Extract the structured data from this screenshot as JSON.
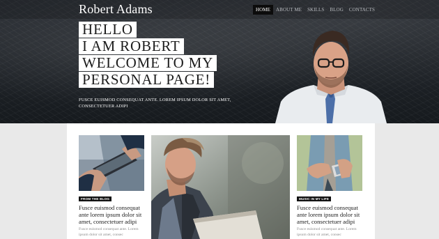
{
  "header": {
    "site_title": "Robert Adams",
    "nav": [
      {
        "label": "HOME",
        "active": true
      },
      {
        "label": "ABOUT ME",
        "active": false
      },
      {
        "label": "SKILLS",
        "active": false
      },
      {
        "label": "BLOG",
        "active": false
      },
      {
        "label": "CONTACTS",
        "active": false
      }
    ]
  },
  "hero": {
    "headline": [
      "HELLO",
      "I AM ROBERT",
      "WELCOME TO MY",
      "PERSONAL PAGE!"
    ],
    "subtitle": "FUSCE EUISMOD CONSEQUAT ANTE. LOREM IPSUM DOLOR SIT AMET, CONSECTETUER ADIPI"
  },
  "cards": [
    {
      "tag": "FROM THE BLOG",
      "title": "Fusce euismod consequat ante lorem ipsum dolor sit amet, consectetuer adipi",
      "text": "Fusce euismod consequat ante. Lorem ipsum dolor sit amet, consec"
    },
    {
      "tag": "MUSIC IN MY LIFE",
      "title": "Fusce euismod consequat ante lorem ipsum dolor sit amet, consectetuer adipi",
      "text": "Fusce euismod consequat ante. Lorem ipsum dolor sit amet, consec"
    }
  ],
  "colors": {
    "hero_bg": "#1f2328",
    "nav_active_bg": "#0c0c0c",
    "tag_bg": "#111111",
    "page_bg": "#e9e9e9"
  }
}
